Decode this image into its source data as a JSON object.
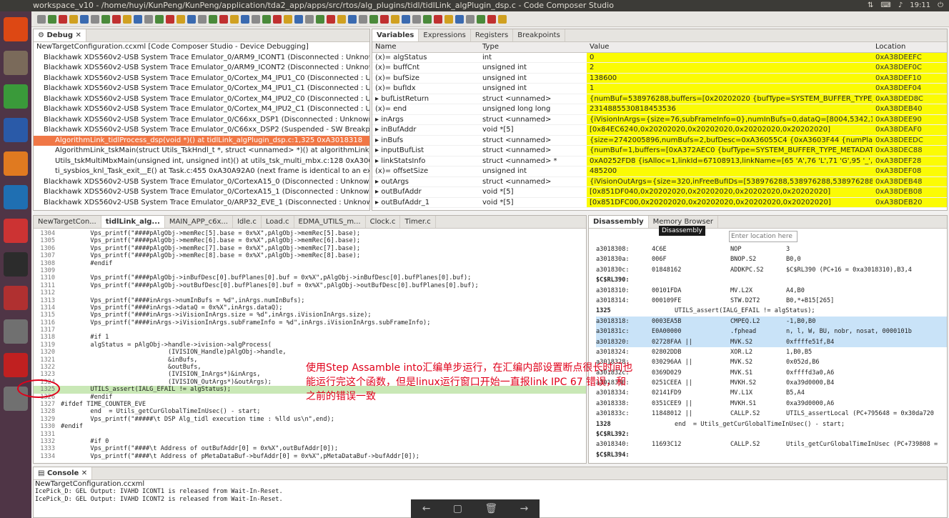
{
  "window": {
    "title": "workspace_v10 - /home/huyi/KunPeng/KunPeng/application/tda2_app/apps/src/rtos/alg_plugins/tidl/tidlLink_algPlugin_dsp.c - Code Composer Studio",
    "time": "19:11"
  },
  "launcher": {
    "items": [
      {
        "name": "ubuntu-icon",
        "color": "#dd4814"
      },
      {
        "name": "files-icon",
        "color": "#7a6a5a"
      },
      {
        "name": "chrome-icon",
        "color": "#3a9a3a"
      },
      {
        "name": "writer-icon",
        "color": "#2a5aa8"
      },
      {
        "name": "software-center-icon",
        "color": "#e07a20"
      },
      {
        "name": "vscode-icon",
        "color": "#1f6fb2"
      },
      {
        "name": "settings-icon",
        "color": "#cc3333"
      },
      {
        "name": "terminal-icon",
        "color": "#2c2c2c"
      },
      {
        "name": "ccs-icon",
        "color": "#b03030"
      },
      {
        "name": "text-editor-icon",
        "color": "#707070"
      },
      {
        "name": "package-icon",
        "color": "#c02020"
      },
      {
        "name": "camera-icon",
        "color": "#707070"
      }
    ]
  },
  "debug": {
    "tab": "Debug",
    "rows": [
      "NewTargetConfiguration.ccxml [Code Composer Studio - Device Debugging]",
      "Blackhawk XDS560v2-USB System Trace Emulator_0/ARM9_ICONT1 (Disconnected : Unknown)",
      "Blackhawk XDS560v2-USB System Trace Emulator_0/ARM9_ICONT2 (Disconnected : Unknown)",
      "Blackhawk XDS560v2-USB System Trace Emulator_0/Cortex_M4_IPU1_C0 (Disconnected : Unkn",
      "Blackhawk XDS560v2-USB System Trace Emulator_0/Cortex_M4_IPU1_C1 (Disconnected : Unkn",
      "Blackhawk XDS560v2-USB System Trace Emulator_0/Cortex_M4_IPU2_C0 (Disconnected : Unkn",
      "Blackhawk XDS560v2-USB System Trace Emulator_0/Cortex_M4_IPU2_C1 (Disconnected : Unkn",
      "Blackhawk XDS560v2-USB System Trace Emulator_0/C66xx_DSP1 (Disconnected : Unknown)",
      "Blackhawk XDS560v2-USB System Trace Emulator_0/C66xx_DSP2 (Suspended - SW Breakpoint)",
      "AlgorithmLink_tidlProcess_dsp(void *)() at tidlLink_algPlugin_dsp.c:1,325 0xA3018318",
      "AlgorithmLink_tskMain(struct Utils_TskHndl_t *, struct <unnamed> *)() at algorithmLink_tsk.",
      "Utils_tskMultiMbxMain(unsigned int, unsigned int)() at utils_tsk_multi_mbx.c:128 0xA30C9FC",
      "ti_sysbios_knl_Task_exit__E() at Task.c:455 0xA30A92A0  (next frame is identical to an existing",
      "Blackhawk XDS560v2-USB System Trace Emulator_0/CortexA15_0 (Disconnected : Unknown)",
      "Blackhawk XDS560v2-USB System Trace Emulator_0/CortexA15_1 (Disconnected : Unknown)",
      "Blackhawk XDS560v2-USB System Trace Emulator_0/ARP32_EVE_1 (Disconnected : Unknown)"
    ]
  },
  "variables": {
    "tabs": [
      "Variables",
      "Expressions",
      "Registers",
      "Breakpoints"
    ],
    "headers": [
      "Name",
      "Type",
      "Value",
      "Location"
    ],
    "rows": [
      [
        "(x)= algStatus",
        "int",
        "0",
        "0xA38DEEFC"
      ],
      [
        "(x)= buffCnt",
        "unsigned int",
        "2",
        "0xA38DEF0C"
      ],
      [
        "(x)= bufSize",
        "unsigned int",
        "138600",
        "0xA38DEF10"
      ],
      [
        "(x)= bufIdx",
        "unsigned int",
        "1",
        "0xA38DEF04"
      ],
      [
        "▸ bufListReturn",
        "struct <unnamed>",
        "{numBuf=538976288,buffers=[0x20202020 {bufType=SYSTEM_BUFFER_TYPE_VID",
        "0xA38DED8C"
      ],
      [
        "(x)= end",
        "unsigned long long",
        "2314885530818453536",
        "0xA38DEB40"
      ],
      [
        "▸ inArgs",
        "struct <unnamed>",
        "{iVisionInArgs={size=76,subFrameInfo=0},numInBufs=0,dataQ=[8004,5342,13930",
        "0xA38DEE90"
      ],
      [
        "▸ inBufAddr",
        "void *[5]",
        "[0x84EC6240,0x20202020,0x20202020,0x20202020,0x20202020]",
        "0xA38DEAF0"
      ],
      [
        "▸ inBufs",
        "struct <unnamed>",
        "{size=2742005896,numBufs=2,bufDesc=0xA36055C4 {0xA3603F44 {numPlanes=1,",
        "0xA38DEEDC"
      ],
      [
        "▸ inputBufList",
        "struct <unnamed>",
        "{numBuf=1,buffers=[0xA372AEC0 {bufType=SYSTEM_BUFFER_TYPE_METADATA",
        "0xA38DEC88"
      ],
      [
        "▸ linkStatsInfo",
        "struct <unnamed> *",
        "0xA0252FD8 {isAlloc=1,linkId=67108913,linkName=[65 'A',76 'L',71 'G',95 '_',84 'T',",
        "0xA38DEF28"
      ],
      [
        "(x)= offsetSize",
        "unsigned int",
        "485200",
        "0xA38DEF08"
      ],
      [
        "▸ outArgs",
        "struct <unnamed>",
        "{iVisionOutArgs={size=320,inFreeBufIDs=[538976288,538976288,538976288,5389",
        "0xA38DEB48"
      ],
      [
        "▸ outBufAddr",
        "void *[5]",
        "[0x851DF040,0x20202020,0x20202020,0x20202020,0x20202020]",
        "0xA38DEB08"
      ],
      [
        "▸ outBufAddr_1",
        "void *[5]",
        "[0x851DFC00,0x20202020,0x20202020,0x20202020,0x20202020]",
        "0xA38DEB20"
      ]
    ]
  },
  "editor": {
    "tabs": [
      "NewTargetCon...",
      "tidlLink_alg...",
      "MAIN_APP_c6x...",
      "Idle.c",
      "Load.c",
      "EDMA_UTILS_m...",
      "Clock.c",
      "Timer.c"
    ],
    "lines": [
      [
        "1304",
        "        Vps_printf(\"####pAlgObj->memRec[5].base = 0x%X\",pAlgObj->memRec[5].base);"
      ],
      [
        "1305",
        "        Vps_printf(\"####pAlgObj->memRec[6].base = 0x%X\",pAlgObj->memRec[6].base);"
      ],
      [
        "1306",
        "        Vps_printf(\"####pAlgObj->memRec[7].base = 0x%X\",pAlgObj->memRec[7].base);"
      ],
      [
        "1307",
        "        Vps_printf(\"####pAlgObj->memRec[8].base = 0x%X\",pAlgObj->memRec[8].base);"
      ],
      [
        "1308",
        "        #endif"
      ],
      [
        "1309",
        ""
      ],
      [
        "1310",
        "        Vps_printf(\"####pAlgObj->inBufDesc[0].bufPlanes[0].buf = 0x%X\",pAlgObj->inBufDesc[0].bufPlanes[0].buf);"
      ],
      [
        "1311",
        "        Vps_printf(\"####pAlgObj->outBufDesc[0].bufPlanes[0].buf = 0x%X\",pAlgObj->outBufDesc[0].bufPlanes[0].buf);"
      ],
      [
        "1312",
        ""
      ],
      [
        "1313",
        "        Vps_printf(\"####inArgs->numInBufs = %d\",inArgs.numInBufs);"
      ],
      [
        "1314",
        "        Vps_printf(\"####inArgs->dataQ = 0x%X\",inArgs.dataQ);"
      ],
      [
        "1315",
        "        Vps_printf(\"####inArgs->iVisionInArgs.size = %d\",inArgs.iVisionInArgs.size);"
      ],
      [
        "1316",
        "        Vps_printf(\"####inArgs->iVisionInArgs.subFrameInfo = %d\",inArgs.iVisionInArgs.subFrameInfo);"
      ],
      [
        "1317",
        ""
      ],
      [
        "1318",
        "        #if 1"
      ],
      [
        "1319",
        "        algStatus = pAlgObj->handle->ivision->algProcess("
      ],
      [
        "1320",
        "                             (IVISION_Handle)pAlgObj->handle,"
      ],
      [
        "1321",
        "                             &inBufs,"
      ],
      [
        "1322",
        "                             &outBufs,"
      ],
      [
        "1323",
        "                             (IVISION_InArgs*)&inArgs,"
      ],
      [
        "1324",
        "                             (IVISION_OutArgs*)&outArgs);"
      ],
      [
        "1325",
        "        UTILS_assert(IALG_EFAIL != algStatus);"
      ],
      [
        "1326",
        "        #endif"
      ],
      [
        "1327",
        "#ifdef TIME_COUNTER_EVE"
      ],
      [
        "1328",
        "        end  = Utils_getCurGlobalTimeInUsec() - start;"
      ],
      [
        "1329",
        "        Vps_printf(\"#####\\t DSP Alg_tidl execution time : %lld us\\n\",end);"
      ],
      [
        "1330",
        "#endif"
      ],
      [
        "1331",
        ""
      ],
      [
        "1332",
        "        #if 0"
      ],
      [
        "1333",
        "        Vps_printf(\"####\\t Address of outBufAddr[0] = 0x%X\",outBufAddr[0]);"
      ],
      [
        "1334",
        "        Vps_printf(\"####\\t Address of pMetaDataBuf->bufAddr[0] = 0x%X\",pMetaDataBuf->bufAddr[0]);"
      ]
    ]
  },
  "disassembly": {
    "tabs": [
      "Disassembly",
      "Memory Browser"
    ],
    "tooltip": "Disassembly",
    "placeholder": "Enter location here",
    "rows": [
      [
        "a3018308:",
        "4C6E",
        "NOP",
        "3"
      ],
      [
        "a301830a:",
        "006F",
        "BNOP.S2",
        "B0,0"
      ],
      [
        "a301830c:",
        "01848162",
        "ADDKPC.S2",
        "$C$RL390 (PC+16 = 0xa3018310),B3,4"
      ],
      [
        "$C$RL390:",
        "",
        "",
        ""
      ],
      [
        "a3018310:",
        "00101FDA",
        "MV.L2X",
        "A4,B0"
      ],
      [
        "a3018314:",
        "000109FE",
        "STW.D2T2",
        "B0,*+B15[265]"
      ],
      [
        "1325",
        "",
        "",
        "UTILS_assert(IALG_EFAIL != algStatus);"
      ],
      [
        "a3018318:",
        "0003EA5B",
        "CMPEQ.L2",
        "-1,B0,B0"
      ],
      [
        "a301831c:",
        "E0A00000",
        ".fphead",
        "n, l, W, BU, nobr, nosat, 0000101b"
      ],
      [
        "a3018320:",
        "02728FAA ||",
        "MVK.S2",
        "0xffffe51f,B4"
      ],
      [
        "a3018324:",
        "02802DDB",
        "XOR.L2",
        "1,B0,B5"
      ],
      [
        "a3018328:",
        "030296AA ||",
        "MVK.S2",
        "0x052d,B6"
      ],
      [
        "a301832c:",
        "0369D029",
        "MVK.S1",
        "0xffffd3a0,A6"
      ],
      [
        "a3018330:",
        "0251CEEA ||",
        "MVKH.S2",
        "0xa39d0000,B4"
      ],
      [
        "a3018334:",
        "02141FD9",
        "MV.L1X",
        "B5,A4"
      ],
      [
        "a3018338:",
        "0351CEE9 ||",
        "MVKH.S1",
        "0xa39d0000,A6"
      ],
      [
        "a301833c:",
        "11848012 ||",
        "CALLP.S2",
        "UTILS_assertLocal (PC+795648 = 0x30da720"
      ],
      [
        "1328",
        "",
        "",
        "end  = Utils_getCurGlobalTimeInUsec() - start;"
      ],
      [
        "$C$RL392:",
        "",
        "",
        ""
      ],
      [
        "a3018340:",
        "11693C12",
        "CALLP.S2",
        "Utils_getCurGlobalTimeInUsec (PC+739808 ="
      ],
      [
        "$C$RL394:",
        "",
        "",
        ""
      ]
    ]
  },
  "console": {
    "tab": "Console",
    "config": "NewTargetConfiguration.ccxml",
    "lines": [
      "IcePick_D: GEL Output: IVAHD ICONT1 is released from Wait-In-Reset.",
      "IcePick_D: GEL Output: IVAHD ICONT2 is released from Wait-In-Reset."
    ]
  },
  "annotation": "使用Step Assamble into汇编单步运行，在汇编内部设置断点很长时间也能运行完这个函数，但是linux运行窗口开始一直报link IPC 67 错误，和之前的错误一致",
  "dock": [
    "←",
    "▢",
    "🗑",
    "→"
  ]
}
